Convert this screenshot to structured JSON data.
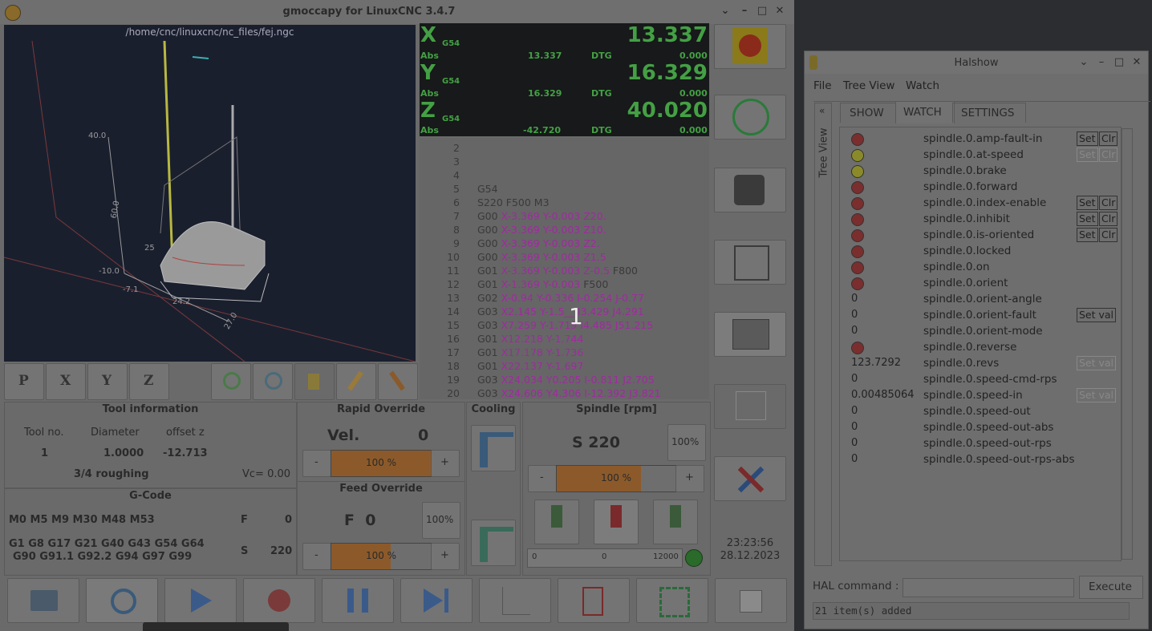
{
  "main_window": {
    "title": "gmoccapy for LinuxCNC  3.4.7",
    "controls": {
      "minimize_down": "⌄",
      "minimize": "–",
      "maximize": "□",
      "close": "✕"
    }
  },
  "preview": {
    "filename": "/home/cnc/linuxcnc/nc_files/fej.ngc",
    "axis_labels": [
      "40.0",
      "60.0",
      "-10.0",
      "-7.1",
      "24.2",
      "27.0",
      "25"
    ],
    "view_buttons": [
      "P",
      "X",
      "Y",
      "Z"
    ]
  },
  "dro": {
    "axes": [
      {
        "name": "X",
        "coord": "G54",
        "value": "13.337",
        "abs_label": "Abs",
        "abs": "13.337",
        "dtg_label": "DTG",
        "dtg": "0.000"
      },
      {
        "name": "Y",
        "coord": "G54",
        "value": "16.329",
        "abs_label": "Abs",
        "abs": "16.329",
        "dtg_label": "DTG",
        "dtg": "0.000"
      },
      {
        "name": "Z",
        "coord": "G54",
        "value": "40.020",
        "abs_label": "Abs",
        "abs": "-42.720",
        "dtg_label": "DTG",
        "dtg": "0.000"
      }
    ]
  },
  "gcode": {
    "overlay_number": "1",
    "lines": [
      {
        "n": "2",
        "plain": "",
        "pos": ""
      },
      {
        "n": "3",
        "plain": "",
        "pos": ""
      },
      {
        "n": "4",
        "plain": "",
        "pos": ""
      },
      {
        "n": "5",
        "plain": "G54",
        "pos": ""
      },
      {
        "n": "6",
        "plain": "S220 F500 M3",
        "pos": ""
      },
      {
        "n": "7",
        "plain": "G00 ",
        "pos": "X-3.369 Y-0.003 Z20."
      },
      {
        "n": "8",
        "plain": "G00 ",
        "pos": "X-3.369 Y-0.003 Z10."
      },
      {
        "n": "9",
        "plain": "G00 ",
        "pos": "X-3.369 Y-0.003 Z2."
      },
      {
        "n": "10",
        "plain": "G00 ",
        "pos": "X-3.369 Y-0.003 Z1.5"
      },
      {
        "n": "11",
        "plain": "G01 ",
        "pos": "X-3.369 Y-0.003 Z-0.5",
        "tail": " F800"
      },
      {
        "n": "12",
        "plain": "G01 ",
        "pos": "X-1.369 Y-0.003",
        "tail": " F500"
      },
      {
        "n": "13",
        "plain": "G02 ",
        "pos": "X-0.94 Y-0.336 I-0.254 J-0.77"
      },
      {
        "n": "14",
        "plain": "G03 ",
        "pos": "X2.145 Y-1.5__ I3.429 J4.291"
      },
      {
        "n": "15",
        "plain": "G03 ",
        "pos": "X7.259 Y-1.719 I4.485 J51.215"
      },
      {
        "n": "16",
        "plain": "G01 ",
        "pos": "X12.218 Y-1.744"
      },
      {
        "n": "17",
        "plain": "G01 ",
        "pos": "X17.178 Y-1.736"
      },
      {
        "n": "18",
        "plain": "G01 ",
        "pos": "X22.137 Y-1.697"
      },
      {
        "n": "19",
        "plain": "G03 ",
        "pos": "X24.034 Y0.205 I-0.811 J2.705"
      },
      {
        "n": "20",
        "plain": "G03 ",
        "pos": "X24.606 Y4.306 I-12.392 J3.821"
      }
    ]
  },
  "tool_info": {
    "title": "Tool information",
    "headers": [
      "Tool no.",
      "Diameter",
      "offset z"
    ],
    "values": [
      "1",
      "1.0000",
      "-12.713"
    ],
    "description": "3/4 roughing",
    "vc": "Vc= 0.00"
  },
  "gcode_info": {
    "title": "G-Code",
    "mcodes": "M0 M5 M9 M30 M48 M53",
    "gcodes_line1": "G1 G8 G17 G21 G40 G43 G54 G64",
    "gcodes_line2": "G90 G91.1 G92.2 G94 G97 G99",
    "f_label": "F",
    "f_value": "0",
    "s_label": "S",
    "s_value": "220"
  },
  "rapid_override": {
    "title": "Rapid Override",
    "label": "Vel.",
    "value": "0",
    "percent": "100 %",
    "minus": "-",
    "plus": "+",
    "fill": 1.0
  },
  "feed_override": {
    "title": "Feed Override",
    "label": "F  0",
    "reset": "100%",
    "percent": "100 %",
    "minus": "-",
    "plus": "+",
    "fill": 0.6
  },
  "cooling": {
    "title": "Cooling"
  },
  "spindle": {
    "title": "Spindle [rpm]",
    "speed": "S 220",
    "reset": "100%",
    "percent": "100 %",
    "minus": "-",
    "plus": "+",
    "fill": 0.71,
    "bar_min": "0",
    "bar_mid": "0",
    "bar_max": "12000",
    "bar_level": 0.0
  },
  "clock": {
    "time": "23:23:56",
    "date": "28.12.2023"
  },
  "halshow": {
    "title": "Halshow",
    "menu": [
      "File",
      "Tree View",
      "Watch"
    ],
    "tree_label": "Tree View",
    "tree_toggle": "«",
    "tabs": [
      "SHOW",
      "WATCH",
      "SETTINGS"
    ],
    "rows": [
      {
        "type": "led",
        "color": "r",
        "name": "spindle.0.amp-fault-in",
        "btns": [
          "Set",
          "Clr"
        ],
        "dim": false
      },
      {
        "type": "led",
        "color": "y",
        "name": "spindle.0.at-speed",
        "btns": [
          "Set",
          "Clr"
        ],
        "dim": true
      },
      {
        "type": "led",
        "color": "y",
        "name": "spindle.0.brake",
        "btns": [],
        "dim": false
      },
      {
        "type": "led",
        "color": "r",
        "name": "spindle.0.forward",
        "btns": [],
        "dim": false
      },
      {
        "type": "led",
        "color": "r",
        "name": "spindle.0.index-enable",
        "btns": [
          "Set",
          "Clr"
        ],
        "dim": false
      },
      {
        "type": "led",
        "color": "r",
        "name": "spindle.0.inhibit",
        "btns": [
          "Set",
          "Clr"
        ],
        "dim": false
      },
      {
        "type": "led",
        "color": "r",
        "name": "spindle.0.is-oriented",
        "btns": [
          "Set",
          "Clr"
        ],
        "dim": false
      },
      {
        "type": "led",
        "color": "r",
        "name": "spindle.0.locked",
        "btns": [],
        "dim": false
      },
      {
        "type": "led",
        "color": "r",
        "name": "spindle.0.on",
        "btns": [],
        "dim": false
      },
      {
        "type": "led",
        "color": "r",
        "name": "spindle.0.orient",
        "btns": [],
        "dim": false
      },
      {
        "type": "val",
        "value": "0",
        "name": "spindle.0.orient-angle",
        "btns": [],
        "dim": false
      },
      {
        "type": "val",
        "value": "0",
        "name": "spindle.0.orient-fault",
        "btns": [
          "Set val"
        ],
        "dim": false
      },
      {
        "type": "val",
        "value": "0",
        "name": "spindle.0.orient-mode",
        "btns": [],
        "dim": false
      },
      {
        "type": "led",
        "color": "r",
        "name": "spindle.0.reverse",
        "btns": [],
        "dim": false
      },
      {
        "type": "val",
        "value": "123.7292",
        "name": "spindle.0.revs",
        "btns": [
          "Set val"
        ],
        "dim": true
      },
      {
        "type": "val",
        "value": "0",
        "name": "spindle.0.speed-cmd-rps",
        "btns": [],
        "dim": false
      },
      {
        "type": "val",
        "value": "0.00485064",
        "name": "spindle.0.speed-in",
        "btns": [
          "Set val"
        ],
        "dim": true
      },
      {
        "type": "val",
        "value": "0",
        "name": "spindle.0.speed-out",
        "btns": [],
        "dim": false
      },
      {
        "type": "val",
        "value": "0",
        "name": "spindle.0.speed-out-abs",
        "btns": [],
        "dim": false
      },
      {
        "type": "val",
        "value": "0",
        "name": "spindle.0.speed-out-rps",
        "btns": [],
        "dim": false
      },
      {
        "type": "val",
        "value": "0",
        "name": "spindle.0.speed-out-rps-abs",
        "btns": [],
        "dim": false
      }
    ],
    "hal_command_label": "HAL command :",
    "hal_command_value": "",
    "execute": "Execute",
    "status": "21 item(s) added"
  },
  "colors": {
    "dro_green": "#44a044",
    "gcode_purple": "#a02aa0",
    "override_orange": "#8c5a2a"
  }
}
